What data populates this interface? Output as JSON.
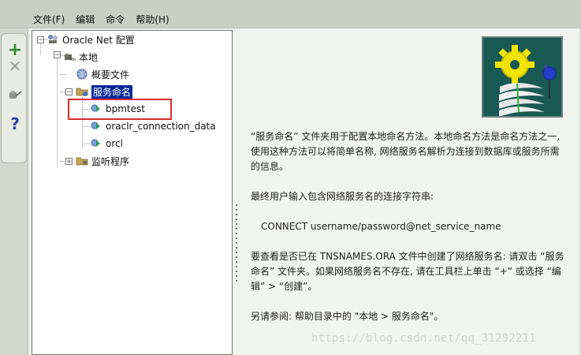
{
  "menu": {
    "file": "文件(F)",
    "edit": "编辑",
    "command": "命令",
    "help": "帮助(H)"
  },
  "toolbar": {
    "add_icon": "plus-icon",
    "delete_icon": "x-icon",
    "test_icon": "test-icon",
    "help_icon": "question-icon"
  },
  "tree": {
    "root": "Oracle Net 配置",
    "local": "本地",
    "profile": "概要文件",
    "service_naming": "服务命名",
    "services": [
      "bpmtest",
      "oraclr_connection_data",
      "orcl"
    ],
    "listener": "监听程序"
  },
  "content": {
    "paragraph1": "“服务命名” 文件夹用于配置本地命名方法。本地命名方法是命名方法之一, 使用这种方法可以将简单名称, 网络服务名解析为连接到数据库或服务所需的信息。",
    "paragraph2": "最终用户输入包含网络服务名的连接字符串:",
    "command": "CONNECT username/password@net_service_name",
    "paragraph3": "要查看是否已在 TNSNAMES.ORA 文件中创建了网络服务名: 请双击 “服务命名” 文件夹。如果网络服务名不存在, 请在工具栏上单击 “+” 或选择 “编辑” > “创建”。",
    "paragraph4": "另请参阅: 帮助目录中的 \"本地 > 服务命名\"。"
  },
  "watermark": "https://blog.csdn.net/qq_31292211",
  "colors": {
    "menubar": "#c9cfc2",
    "selected_node": "#0a2a9a",
    "highlight": "#d62b2b"
  }
}
